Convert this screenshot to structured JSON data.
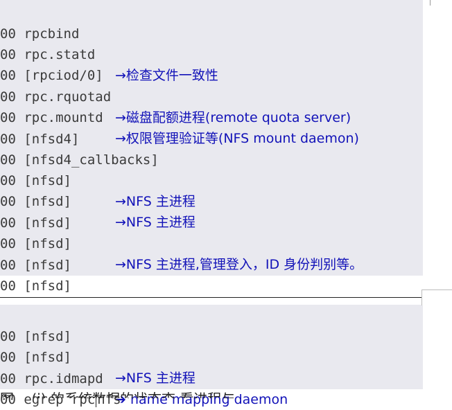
{
  "top_block": [
    {
      "code": "00 rpcbind",
      "note": ""
    },
    {
      "code": "00 rpc.statd",
      "note": "→检查文件一致性"
    },
    {
      "code": "00 [rpciod/0]",
      "note": ""
    },
    {
      "code": "00 rpc.rquotad",
      "note": "→磁盘配额进程(remote quota server)"
    },
    {
      "code": "00 rpc.mountd",
      "note": "→权限管理验证等(NFS mount daemon)"
    },
    {
      "code": "00 [nfsd4]",
      "note": ""
    },
    {
      "code": "00 [nfsd4_callbacks]",
      "note": ""
    },
    {
      "code": "00 [nfsd]",
      "note": "→NFS 主进程"
    },
    {
      "code": "00 [nfsd]",
      "note": "→NFS 主进程"
    },
    {
      "code": "00 [nfsd]",
      "note": ""
    },
    {
      "code": "00 [nfsd]",
      "note": "→NFS 主进程,管理登入，ID 身份判别等。"
    },
    {
      "code": "00 [nfsd]",
      "note": ""
    },
    {
      "code": "00 [nfsd]",
      "note": ""
    }
  ],
  "bottom_block": [
    {
      "code": "00 [nfsd]",
      "note": ""
    },
    {
      "code": "00 [nfsd]",
      "note": "→NFS 主进程"
    },
    {
      "code": "00 rpc.idmapd",
      "note": "➔ name mapping daemon"
    },
    {
      "code_before_cursor": "00 egrep rpc",
      "code_after_cursor": "nfs",
      "note": ""
    }
  ],
  "caption": "图    (i) 的系统数据的状态查 看进程与   "
}
